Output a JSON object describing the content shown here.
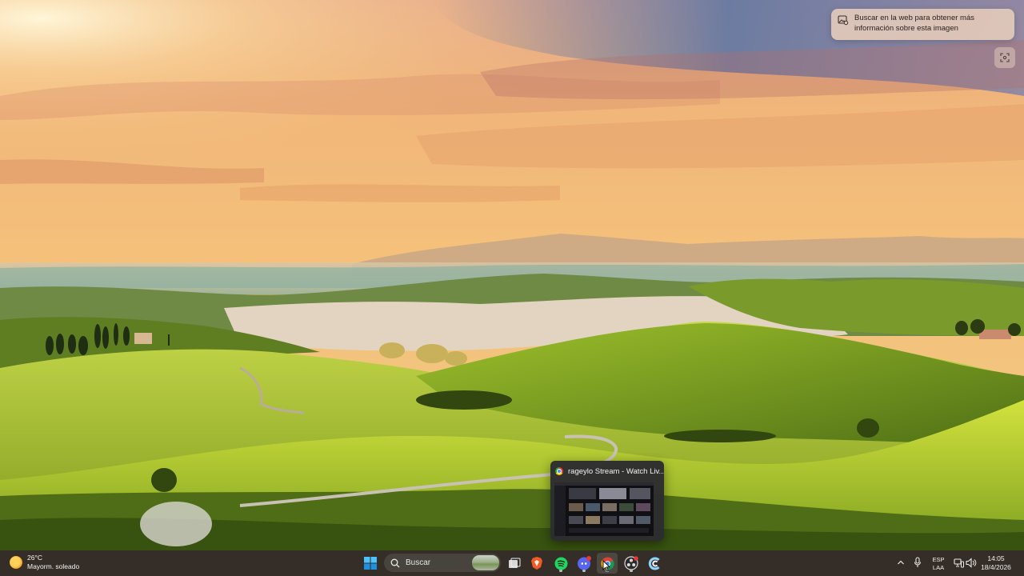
{
  "desktop": {
    "spotlight_tooltip": "Buscar en la web para obtener más información sobre esta imagen",
    "spotlight_icon": "image-search-icon",
    "spotlight_button_icon": "focus-frame-icon"
  },
  "preview": {
    "title": "rageylo Stream - Watch Liv..."
  },
  "taskbar": {
    "weather": {
      "temp": "26°C",
      "condition": "Mayorm. soleado"
    },
    "search_placeholder": "Buscar",
    "apps": [
      "windows-start-icon",
      "search-icon",
      "task-view-icon",
      "brave-icon",
      "spotify-icon",
      "discord-icon",
      "chrome-icon",
      "obs-icon",
      "ccleaner-icon"
    ],
    "tray": {
      "lang_line1": "ESP",
      "lang_line2": "LAA",
      "time": "14:05",
      "date": "18/4/2026"
    },
    "accent": "#0078d4"
  }
}
